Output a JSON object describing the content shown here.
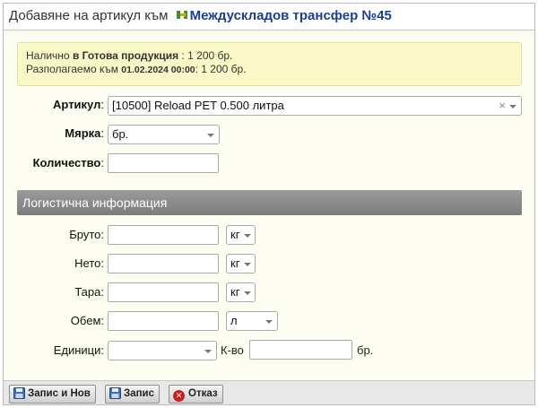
{
  "dialog": {
    "title_prefix": "Добавяне на артикул към",
    "title_link": "Междускладов трансфер №45"
  },
  "notice": {
    "line1_prefix": "Налично",
    "line1_store": "в Готова продукция",
    "line1_value": ": 1 200 бр.",
    "line2_prefix": "Разполагаемо към",
    "line2_date": "01.02.2024 00:00",
    "line2_value": ": 1 200 бр."
  },
  "form": {
    "article": {
      "label": "Артикул",
      "value": "[10500] Reload PET 0.500 литра",
      "clear": "×"
    },
    "measure": {
      "label": "Мярка",
      "value": "бр."
    },
    "quantity": {
      "label": "Количество",
      "value": ""
    },
    "colon": ":"
  },
  "logistics": {
    "title": "Логистична информация",
    "gross": {
      "label": "Бруто:",
      "value": "",
      "unit": "кг"
    },
    "net": {
      "label": "Нето:",
      "value": "",
      "unit": "кг"
    },
    "tare": {
      "label": "Тара:",
      "value": "",
      "unit": "кг"
    },
    "volume": {
      "label": "Обем:",
      "value": "",
      "unit": "л"
    },
    "units": {
      "label": "Единици:",
      "value": "",
      "qty_label": "К-во",
      "qty_value": "",
      "qty_unit": "бр."
    }
  },
  "footer": {
    "save_new": "Запис и Нов",
    "save": "Запис",
    "cancel": "Отказ"
  }
}
